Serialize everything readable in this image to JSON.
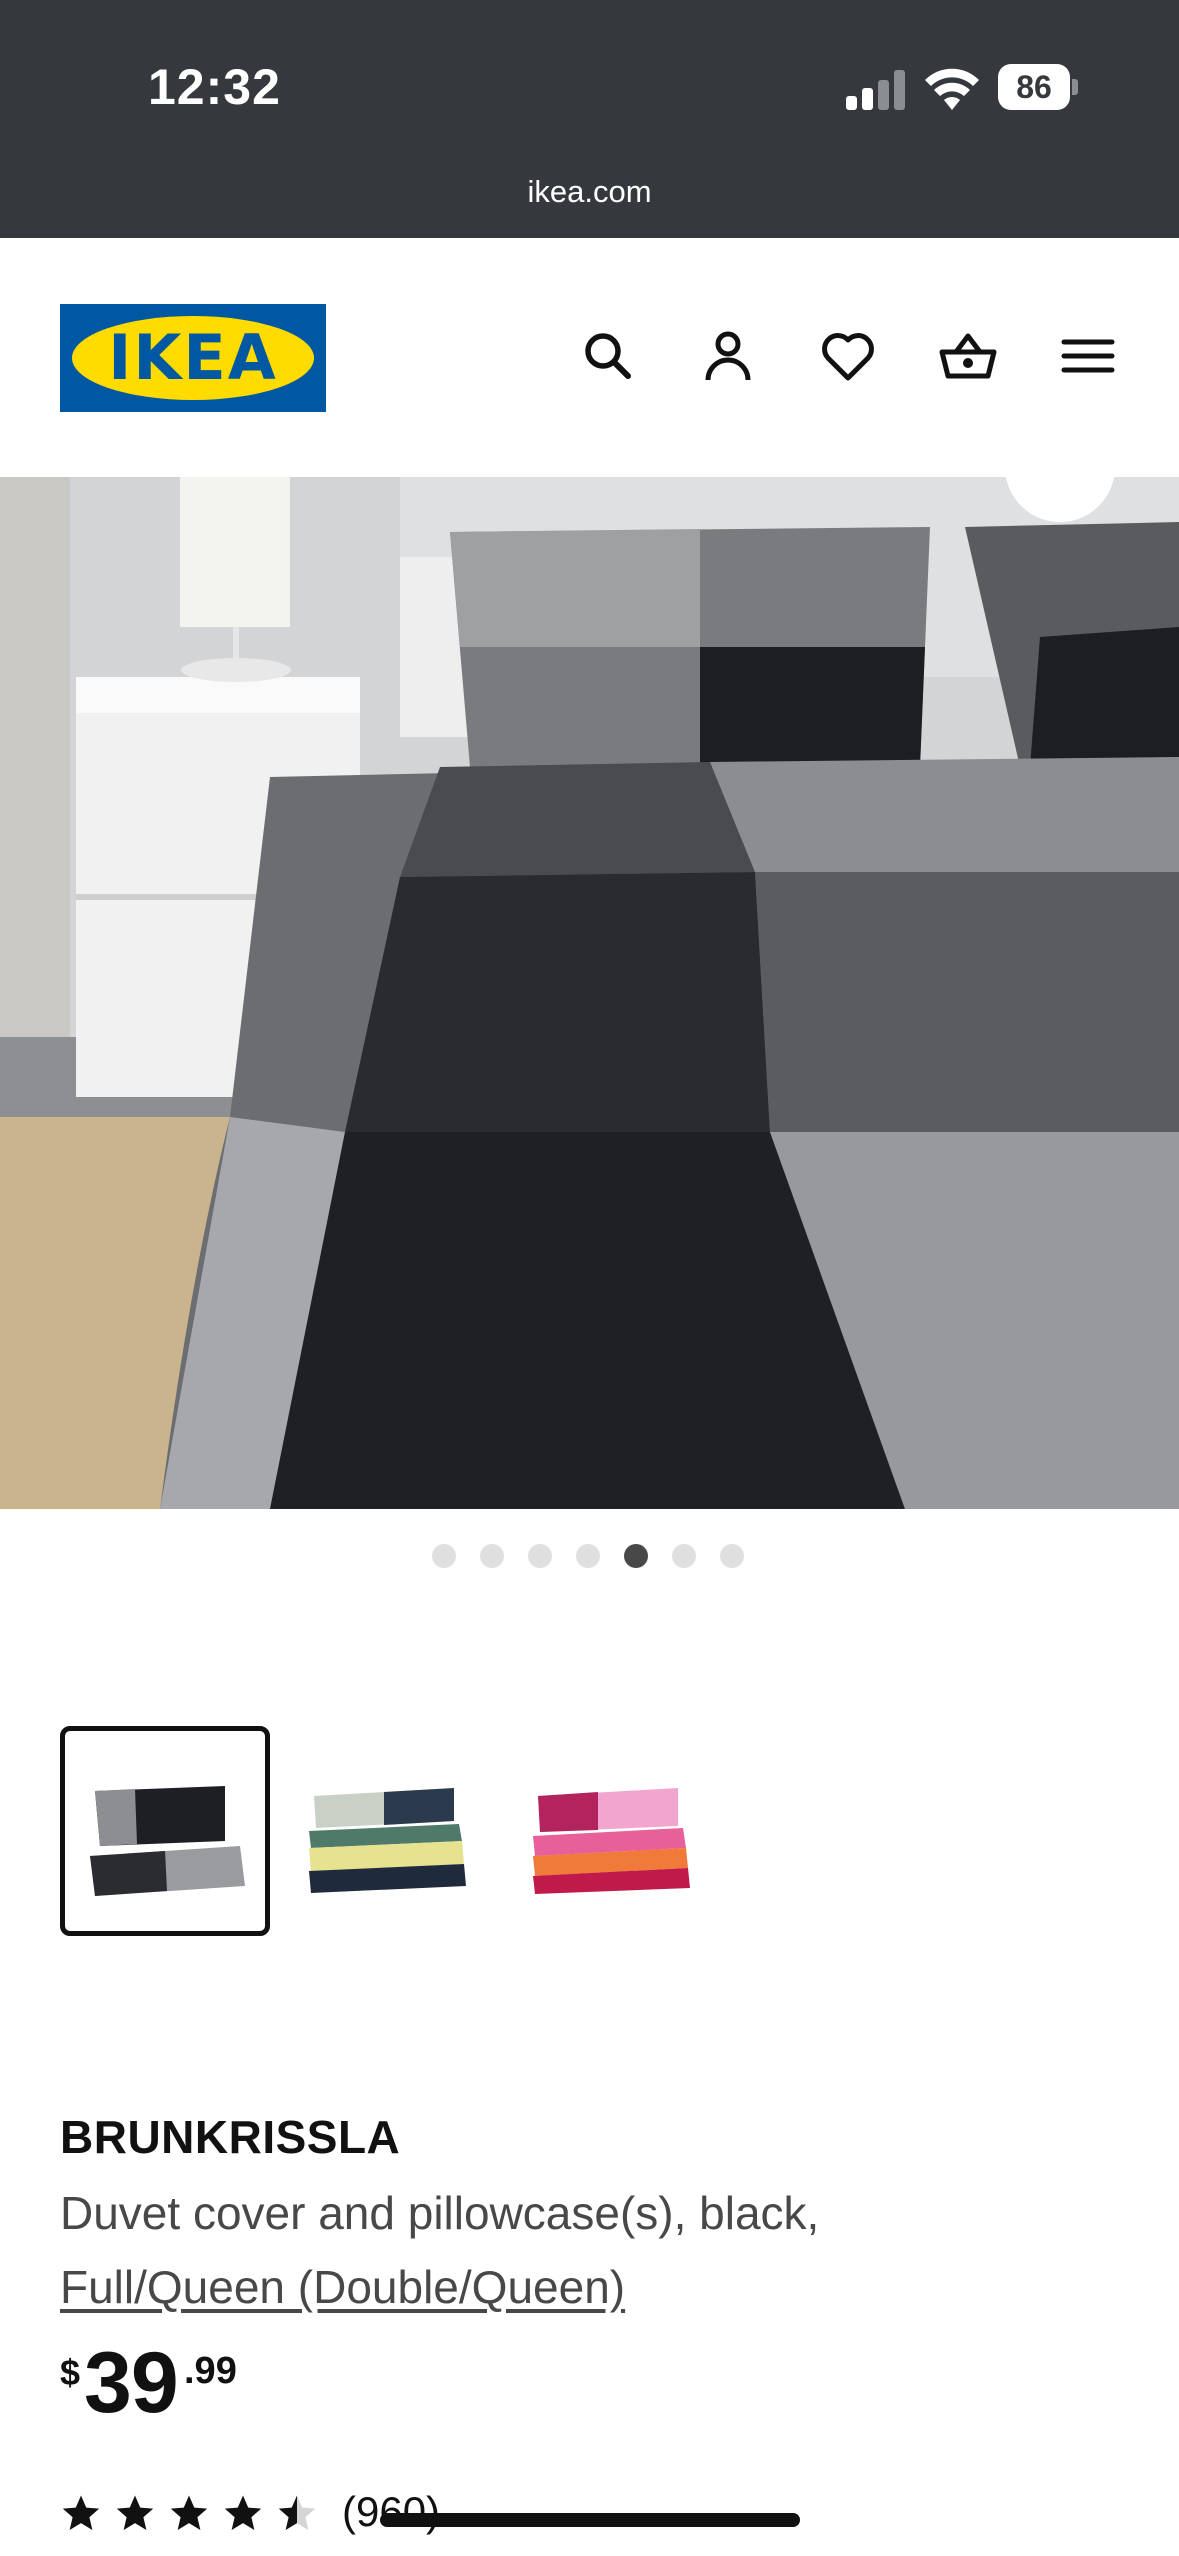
{
  "status_bar": {
    "time": "12:32",
    "battery": "86"
  },
  "browser": {
    "url": "ikea.com"
  },
  "header": {
    "logo_text": "IKEA",
    "icons": [
      "search-icon",
      "account-icon",
      "heart-icon",
      "basket-icon",
      "menu-icon"
    ]
  },
  "gallery": {
    "dots_total": 7,
    "active_index": 4
  },
  "thumbnails": [
    {
      "name": "black",
      "selected": true
    },
    {
      "name": "multicolor",
      "selected": false
    },
    {
      "name": "pink",
      "selected": false
    }
  ],
  "product": {
    "name": "BRUNKRISSLA",
    "description": "Duvet cover and pillowcase(s), black,",
    "size": "Full/Queen (Double/Queen)",
    "price_currency": "$",
    "price_whole": "39",
    "price_decimal": ".99",
    "rating": 4.5,
    "review_count": "(960)"
  },
  "colors": {
    "topbar": "#35383c",
    "logo_blue": "#0058a3",
    "logo_yellow": "#ffdb00"
  }
}
